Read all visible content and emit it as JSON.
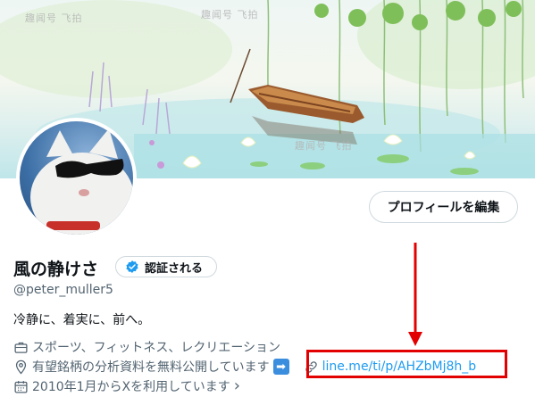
{
  "banner": {
    "watermarks": [
      "趣闻号 飞拍",
      "趣闻号 飞拍",
      "趣闻号 飞拍"
    ]
  },
  "profile": {
    "edit_button_label": "プロフィールを編集",
    "display_name": "風の静けさ",
    "verify_label": "認証される",
    "handle": "@peter_muller5",
    "bio": "冷静に、着実に、前へ。",
    "category": "スポーツ、フィットネス、レクリエーション",
    "location": "有望銘柄の分析資料を無料公開しています",
    "location_emoji": "➡",
    "link": "line.me/ti/p/AHZbMj8h_b",
    "joined": "2010年1月からXを利用しています",
    "joined_chevron": "›"
  },
  "colors": {
    "accent_link": "#1d9bf0",
    "verified_blue": "#1d9bf0",
    "annotation_red": "#e30000",
    "secondary_text": "#536471"
  },
  "icons": [
    "briefcase-icon",
    "location-pin-icon",
    "link-icon",
    "calendar-icon",
    "verified-badge-icon",
    "arrow-right-emoji-icon"
  ]
}
